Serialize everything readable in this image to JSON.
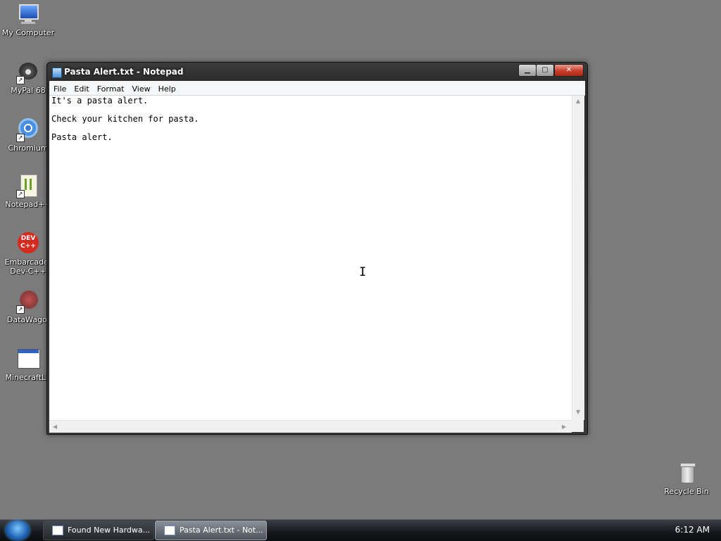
{
  "desktop": {
    "icons": [
      {
        "label": "My Computer"
      },
      {
        "label": "MyPal 68"
      },
      {
        "label": "Chromium"
      },
      {
        "label": "Notepad++"
      },
      {
        "label": "Embarcader\nDev-C++"
      },
      {
        "label": "DataWago."
      },
      {
        "label": "MinecraftLit"
      },
      {
        "label": "Recycle Bin"
      }
    ]
  },
  "window": {
    "title": "Pasta Alert.txt - Notepad",
    "buttons": {
      "minimize": "▁",
      "maximize": "▢",
      "close": "✕"
    },
    "menu": [
      "File",
      "Edit",
      "Format",
      "View",
      "Help"
    ],
    "content_lines": [
      "It's a pasta alert.",
      "Check your kitchen for pasta.",
      "Pasta alert."
    ]
  },
  "cursor": {
    "glyph": "I"
  },
  "taskbar": {
    "tasks": [
      {
        "label": "Found New Hardwa..."
      },
      {
        "label": "Pasta Alert.txt - Not..."
      }
    ],
    "clock": "6:12 AM"
  },
  "colors": {
    "desktop_bg": "#7b7b7b",
    "close_button": "#c7402c",
    "taskbar": "#14171b"
  }
}
